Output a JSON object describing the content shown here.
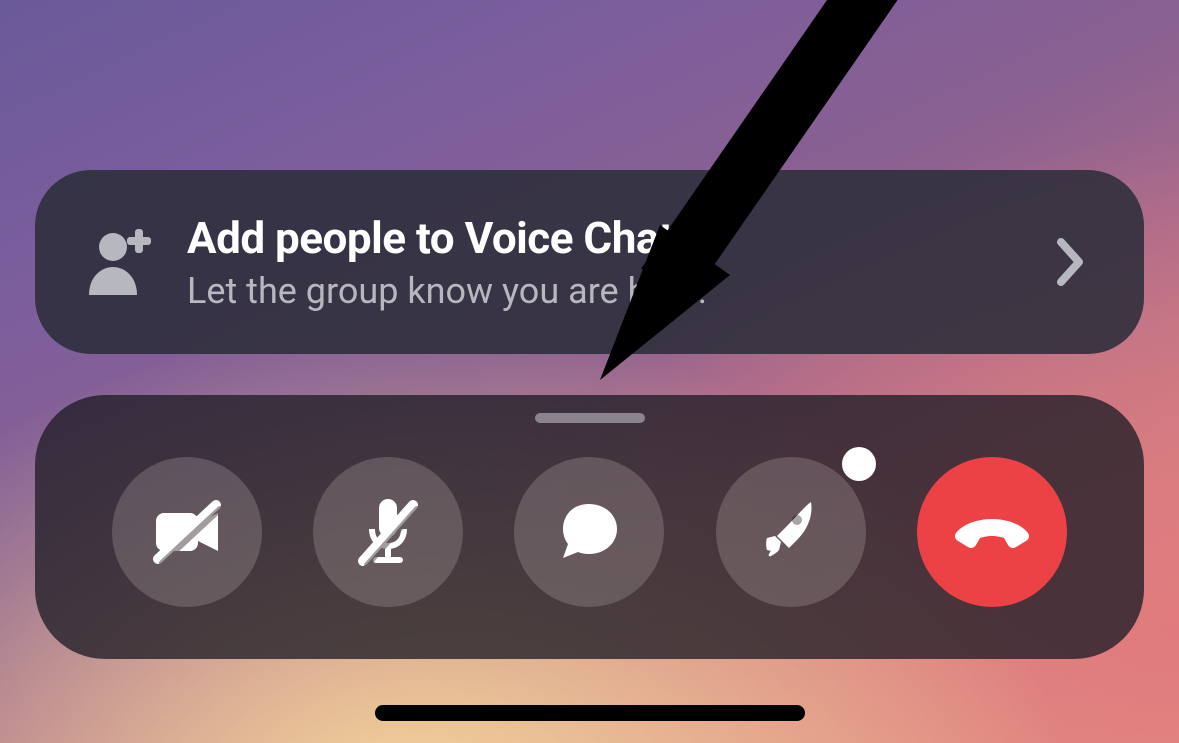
{
  "add_people": {
    "title": "Add people to Voice Chat",
    "subtitle": "Let the group know you are here!"
  },
  "controls": {
    "video": {
      "on": false
    },
    "mic": {
      "on": false
    },
    "chat": {},
    "activities": {
      "has_notification": true
    },
    "end_call": {}
  },
  "annotation": {
    "description": "Arrow pointing from top-right corner down toward the control bar"
  }
}
